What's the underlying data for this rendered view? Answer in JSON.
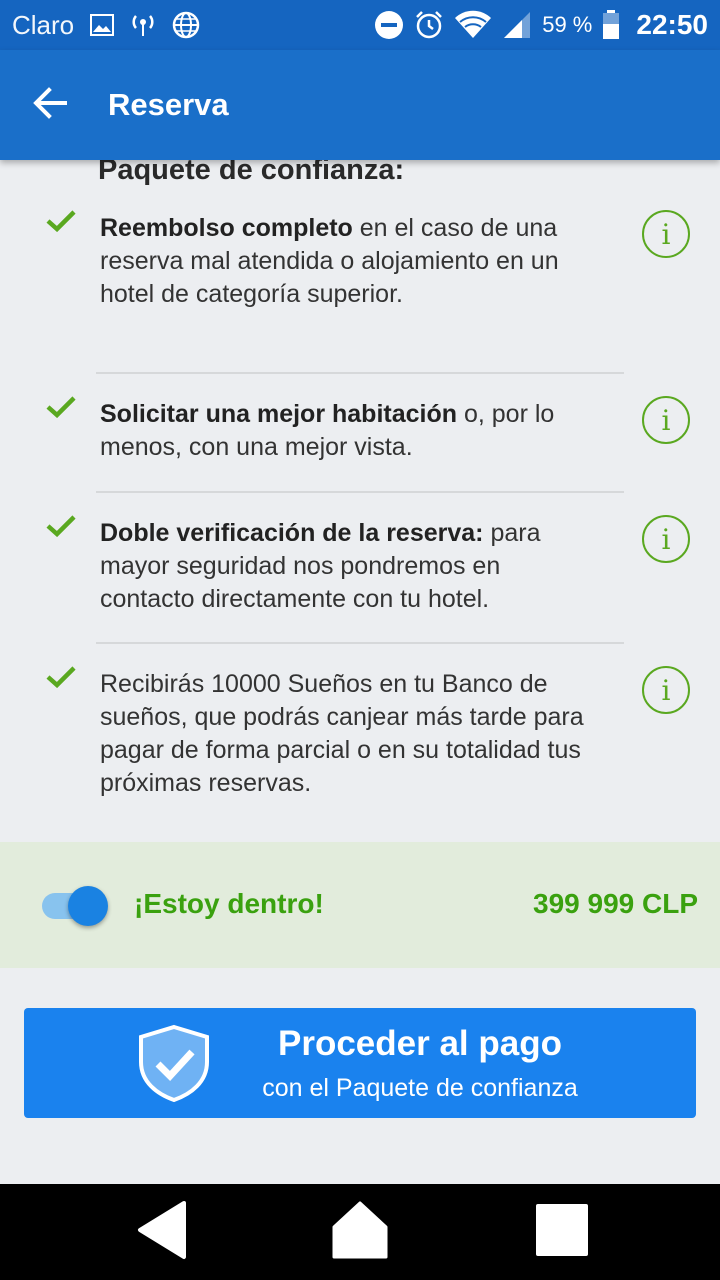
{
  "status_bar": {
    "carrier": "Claro",
    "battery_percent": "59 %",
    "time": "22:50",
    "icons": [
      "image-icon",
      "hotspot-icon",
      "globe-icon",
      "do-not-disturb-icon",
      "alarm-icon",
      "wifi-icon",
      "signal-icon",
      "battery-icon"
    ]
  },
  "app_bar": {
    "title": "Reserva",
    "back_icon": "back-arrow-icon"
  },
  "package": {
    "title": "Paquete de confianza:",
    "features": [
      {
        "bold": "Reembolso completo",
        "text": " en el caso de una reserva mal atendida o alojamiento en un hotel de categoría superior."
      },
      {
        "bold": "Solicitar una mejor habitación",
        "text": " o, por lo menos, con una mejor vista."
      },
      {
        "bold": "Doble verificación de la reserva:",
        "text": " para mayor seguridad nos pondremos en contacto directamente con tu hotel."
      },
      {
        "bold": "",
        "text": "Recibirás 10000 Sueños en tu Banco de sueños, que podrás canjear más tarde para pagar de forma parcial o en su totalidad tus próximas reservas."
      }
    ],
    "info_glyph": "i"
  },
  "optin": {
    "label": "¡Estoy dentro!",
    "price": "399 999 CLP",
    "toggle_on": true
  },
  "pay_button": {
    "main_label": "Proceder al pago",
    "sub_label": "con el Paquete de confianza"
  },
  "colors": {
    "primary": "#1a6fc9",
    "accent_green": "#5aa820",
    "button_blue": "#1a82ee"
  }
}
